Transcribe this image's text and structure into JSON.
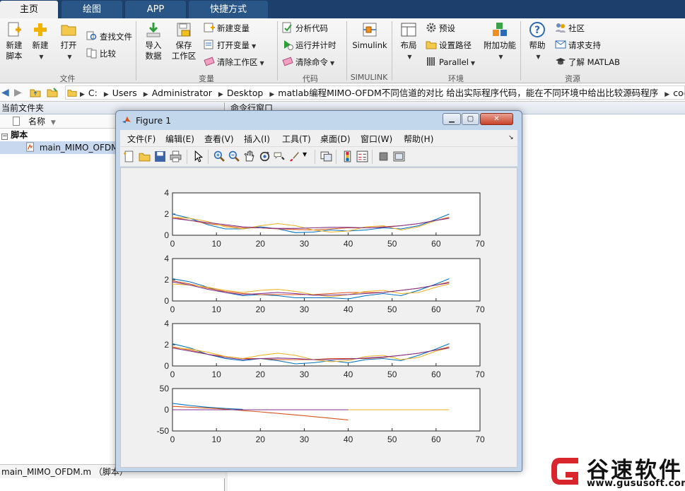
{
  "tabs": [
    "主页",
    "绘图",
    "APP",
    "快捷方式"
  ],
  "active_tab": 0,
  "ribbon": {
    "file": {
      "group_label": "文件",
      "new_script": [
        "新建",
        "脚本"
      ],
      "new": "新建",
      "open": "打开",
      "find_files": "查找文件",
      "compare": "比较"
    },
    "variable": {
      "group_label": "变量",
      "import": [
        "导入",
        "数据"
      ],
      "save_workspace": [
        "保存",
        "工作区"
      ],
      "new_variable": "新建变量",
      "open_variable": "打开变量",
      "clear_workspace": "清除工作区"
    },
    "code": {
      "group_label": "代码",
      "analyze": "分析代码",
      "run_time": "运行并计时",
      "clear_commands": "清除命令"
    },
    "simulink": {
      "group_label": "SIMULINK",
      "simulink": "Simulink"
    },
    "environment": {
      "group_label": "环境",
      "layout": "布局",
      "preferences": "预设",
      "set_path": "设置路径",
      "parallel": "Parallel",
      "addons": "附加功能"
    },
    "resources": {
      "group_label": "资源",
      "help": "帮助",
      "community": "社区",
      "request_support": "请求支持",
      "learn_matlab": "了解 MATLAB"
    }
  },
  "address": {
    "crumbs": [
      "C:",
      "Users",
      "Administrator",
      "Desktop",
      "matlab编程MIMO-OFDM不同信道的对比 给出实际程序代码，能在不同环境中给出比较源码程序",
      "code"
    ]
  },
  "current_folder": {
    "title": "当前文件夹",
    "column_name": "名称",
    "group": "脚本",
    "file": "main_MIMO_OFDM.m",
    "file_visible": "main_MIMO_OFDM",
    "detail": "main_MIMO_OFDM.m （脚本）"
  },
  "command_window": {
    "title": "命令行窗口"
  },
  "figure": {
    "title": "Figure 1",
    "menus": [
      "文件(F)",
      "编辑(E)",
      "查看(V)",
      "插入(I)",
      "工具(T)",
      "桌面(D)",
      "窗口(W)",
      "帮助(H)"
    ],
    "toolbar_icons": [
      "new-figure-icon",
      "open-file-icon",
      "save-icon",
      "print-icon",
      "pointer-icon",
      "zoom-in-icon",
      "zoom-out-icon",
      "pan-icon",
      "rotate-icon",
      "data-cursor-icon",
      "brush-icon",
      "link-plot-icon",
      "colorbar-icon",
      "legend-icon",
      "hide-plot-tools-icon",
      "show-plot-tools-icon"
    ]
  },
  "watermark": {
    "brand": "谷速软件",
    "url": "www.gususoft.com",
    "color": "#d8262c"
  },
  "colors": {
    "series": [
      "#0072bd",
      "#d95319",
      "#edb120",
      "#7e2f8e"
    ]
  },
  "chart_data": [
    {
      "type": "line",
      "xlim": [
        0,
        70
      ],
      "ylim": [
        0,
        4
      ],
      "xticks": [
        0,
        10,
        20,
        30,
        40,
        50,
        60,
        70
      ],
      "yticks": [
        0,
        2,
        4
      ],
      "series": [
        {
          "color": "#0072bd",
          "x": [
            0,
            4,
            8,
            12,
            16,
            20,
            24,
            28,
            32,
            36,
            40,
            44,
            48,
            52,
            56,
            60,
            63
          ],
          "values": [
            2.0,
            1.6,
            1.0,
            0.6,
            0.6,
            0.8,
            0.6,
            0.25,
            0.3,
            0.5,
            0.4,
            0.5,
            0.7,
            0.6,
            0.9,
            1.5,
            2.0
          ]
        },
        {
          "color": "#d95319",
          "x": [
            0,
            4,
            8,
            12,
            16,
            20,
            24,
            28,
            32,
            36,
            40,
            44,
            48,
            52,
            56,
            60,
            63
          ],
          "values": [
            1.7,
            1.4,
            1.1,
            0.9,
            0.7,
            0.7,
            0.6,
            0.55,
            0.5,
            0.6,
            0.7,
            0.7,
            0.8,
            0.9,
            1.1,
            1.4,
            1.7
          ]
        },
        {
          "color": "#edb120",
          "x": [
            0,
            4,
            8,
            12,
            16,
            20,
            24,
            28,
            32,
            36,
            40,
            44,
            48,
            52,
            56,
            60,
            63
          ],
          "values": [
            1.7,
            1.6,
            1.3,
            0.8,
            0.6,
            0.9,
            1.1,
            0.9,
            0.5,
            0.3,
            0.4,
            0.8,
            0.9,
            0.5,
            0.8,
            1.4,
            1.6
          ]
        },
        {
          "color": "#7e2f8e",
          "x": [
            0,
            4,
            8,
            12,
            16,
            20,
            24,
            28,
            32,
            36,
            40,
            44,
            48,
            52,
            56,
            60,
            63
          ],
          "values": [
            1.6,
            1.4,
            1.2,
            1.0,
            0.8,
            0.7,
            0.65,
            0.65,
            0.7,
            0.75,
            0.75,
            0.7,
            0.75,
            0.9,
            1.1,
            1.4,
            1.6
          ]
        }
      ]
    },
    {
      "type": "line",
      "xlim": [
        0,
        70
      ],
      "ylim": [
        0,
        4
      ],
      "xticks": [
        0,
        10,
        20,
        30,
        40,
        50,
        60,
        70
      ],
      "yticks": [
        0,
        2,
        4
      ],
      "series": [
        {
          "color": "#0072bd",
          "x": [
            0,
            4,
            8,
            12,
            16,
            20,
            24,
            28,
            32,
            36,
            40,
            44,
            48,
            52,
            56,
            60,
            63
          ],
          "values": [
            2.1,
            1.8,
            1.3,
            0.8,
            0.5,
            0.6,
            0.5,
            0.3,
            0.3,
            0.3,
            0.2,
            0.5,
            0.7,
            0.5,
            1.0,
            1.6,
            2.1
          ]
        },
        {
          "color": "#d95319",
          "x": [
            0,
            4,
            8,
            12,
            16,
            20,
            24,
            28,
            32,
            36,
            40,
            44,
            48,
            52,
            56,
            60,
            63
          ],
          "values": [
            1.9,
            1.6,
            1.2,
            0.9,
            0.7,
            0.6,
            0.6,
            0.6,
            0.6,
            0.7,
            0.8,
            0.8,
            0.8,
            1.0,
            1.2,
            1.5,
            1.8
          ]
        },
        {
          "color": "#edb120",
          "x": [
            0,
            4,
            8,
            12,
            16,
            20,
            24,
            28,
            32,
            36,
            40,
            44,
            48,
            52,
            56,
            60,
            63
          ],
          "values": [
            1.6,
            1.5,
            1.3,
            1.0,
            0.8,
            1.0,
            1.1,
            0.9,
            0.6,
            0.4,
            0.6,
            0.9,
            1.0,
            0.7,
            0.8,
            1.3,
            1.6
          ]
        },
        {
          "color": "#7e2f8e",
          "x": [
            0,
            4,
            8,
            12,
            16,
            20,
            24,
            28,
            32,
            36,
            40,
            44,
            48,
            52,
            56,
            60,
            63
          ],
          "values": [
            1.8,
            1.5,
            1.1,
            0.8,
            0.6,
            0.7,
            0.8,
            0.7,
            0.55,
            0.55,
            0.6,
            0.7,
            0.8,
            1.0,
            1.2,
            1.5,
            1.7
          ]
        }
      ]
    },
    {
      "type": "line",
      "xlim": [
        0,
        70
      ],
      "ylim": [
        0,
        4
      ],
      "xticks": [
        0,
        10,
        20,
        30,
        40,
        50,
        60,
        70
      ],
      "yticks": [
        0,
        2,
        4
      ],
      "series": [
        {
          "color": "#0072bd",
          "x": [
            0,
            4,
            8,
            12,
            16,
            20,
            24,
            28,
            32,
            36,
            40,
            44,
            48,
            52,
            56,
            60,
            63
          ],
          "values": [
            2.1,
            1.7,
            1.1,
            0.7,
            0.5,
            0.7,
            0.5,
            0.2,
            0.3,
            0.5,
            0.3,
            0.6,
            0.7,
            0.5,
            1.0,
            1.6,
            2.1
          ]
        },
        {
          "color": "#d95319",
          "x": [
            0,
            4,
            8,
            12,
            16,
            20,
            24,
            28,
            32,
            36,
            40,
            44,
            48,
            52,
            56,
            60,
            63
          ],
          "values": [
            1.8,
            1.5,
            1.1,
            0.9,
            0.7,
            0.7,
            0.6,
            0.6,
            0.6,
            0.7,
            0.7,
            0.7,
            0.8,
            1.0,
            1.2,
            1.5,
            1.8
          ]
        },
        {
          "color": "#edb120",
          "x": [
            0,
            4,
            8,
            12,
            16,
            20,
            24,
            28,
            32,
            36,
            40,
            44,
            48,
            52,
            56,
            60,
            63
          ],
          "values": [
            1.7,
            1.6,
            1.3,
            0.9,
            0.7,
            1.0,
            1.2,
            1.0,
            0.6,
            0.4,
            0.5,
            0.9,
            1.0,
            0.6,
            0.8,
            1.4,
            1.7
          ]
        },
        {
          "color": "#7e2f8e",
          "x": [
            0,
            4,
            8,
            12,
            16,
            20,
            24,
            28,
            32,
            36,
            40,
            44,
            48,
            52,
            56,
            60,
            63
          ],
          "values": [
            1.7,
            1.4,
            1.1,
            0.8,
            0.6,
            0.7,
            0.75,
            0.7,
            0.6,
            0.6,
            0.65,
            0.75,
            0.85,
            1.0,
            1.2,
            1.5,
            1.7
          ]
        }
      ]
    },
    {
      "type": "line",
      "xlim": [
        0,
        70
      ],
      "ylim": [
        -50,
        50
      ],
      "xticks": [
        0,
        10,
        20,
        30,
        40,
        50,
        60,
        70
      ],
      "yticks": [
        -50,
        0,
        50
      ],
      "series": [
        {
          "color": "#0072bd",
          "x": [
            0,
            4,
            8,
            12,
            16
          ],
          "values": [
            15,
            10,
            6,
            3,
            1
          ]
        },
        {
          "color": "#d95319",
          "x": [
            0,
            10,
            20,
            30,
            40
          ],
          "values": [
            8,
            3,
            -5,
            -14,
            -24
          ]
        },
        {
          "color": "#edb120",
          "x": [
            0,
            63
          ],
          "values": [
            0,
            0
          ]
        },
        {
          "color": "#7e2f8e",
          "x": [
            0,
            40
          ],
          "values": [
            0,
            0
          ]
        }
      ]
    }
  ]
}
